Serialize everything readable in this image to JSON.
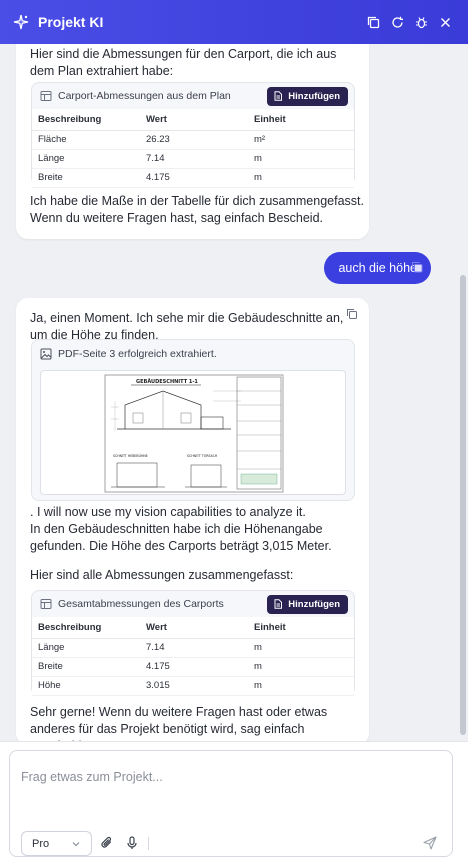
{
  "header": {
    "title": "Projekt KI",
    "icons": [
      "sparkles-icon",
      "copy-icon",
      "refresh-icon",
      "bug-icon",
      "close-icon"
    ],
    "color": "#3b3fe0"
  },
  "messages": {
    "first": {
      "intro": "Hier sind die Abmessungen für den Carport, die ich aus dem Plan extrahiert habe:",
      "table": {
        "title": "Carport-Abmessungen aus dem Plan",
        "add_label": "Hinzufügen",
        "headers": [
          "Beschreibung",
          "Wert",
          "Einheit"
        ],
        "rows": [
          [
            "Fläche",
            "26.23",
            "m²"
          ],
          [
            "Länge",
            "7.14",
            "m"
          ],
          [
            "Breite",
            "4.175",
            "m"
          ]
        ]
      },
      "outro": "Ich habe die Maße in der Tabelle für dich zusammengefasst. Wenn du weitere Fragen hast, sag einfach Bescheid."
    },
    "user": {
      "text": "auch die höhe"
    },
    "second": {
      "intro": "Ja, einen Moment. Ich sehe mir die Gebäudeschnitte an, um die Höhe zu finden.",
      "pdf_label": "PDF-Seite 3 erfolgreich extrahiert.",
      "plan_title": "GEBÄUDESCHNITT 1-1",
      "plan_labels": [
        "SCHNITT HEBEBÜHNE",
        "SCHNITT TOREACH"
      ],
      "analysis": ". I will now use my vision capabilities to analyze it.",
      "result": "In den Gebäudeschnitten habe ich die Höhenangabe gefunden. Die Höhe des Carports beträgt 3,015 Meter.",
      "summary": "Hier sind alle Abmessungen zusammengefasst:",
      "table": {
        "title": "Gesamtabmessungen des Carports",
        "add_label": "Hinzufügen",
        "headers": [
          "Beschreibung",
          "Wert",
          "Einheit"
        ],
        "rows": [
          [
            "Länge",
            "7.14",
            "m"
          ],
          [
            "Breite",
            "4.175",
            "m"
          ],
          [
            "Höhe",
            "3.015",
            "m"
          ]
        ]
      },
      "outro": "Sehr gerne! Wenn du weitere Fragen hast oder etwas anderes für das Projekt benötigt wird, sag einfach Bescheid."
    }
  },
  "composer": {
    "placeholder": "Frag etwas zum Projekt...",
    "model": "Pro",
    "icons": [
      "attach-icon",
      "microphone-icon",
      "send-icon"
    ]
  }
}
